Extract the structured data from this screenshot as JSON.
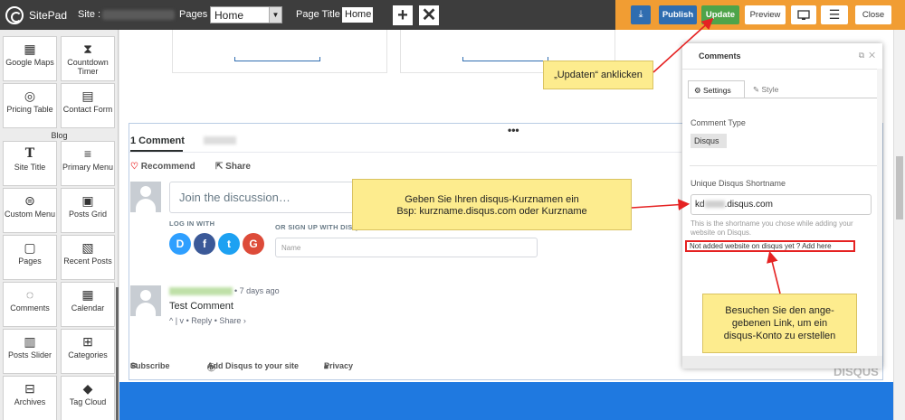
{
  "topbar": {
    "brand": "SitePad",
    "site_label": "Site :",
    "pages_label": "Pages :",
    "pages_value": "Home",
    "page_title_label": "Page Title :",
    "page_title_value": "Home",
    "buttons": {
      "publish": "Publish",
      "update": "Update",
      "preview": "Preview",
      "close": "Close"
    }
  },
  "sidebar": {
    "widgets_top": [
      {
        "label": "Google Maps",
        "icon": "grid-icon"
      },
      {
        "label": "Countdown Timer",
        "icon": "hourglass-icon"
      },
      {
        "label": "Pricing Table",
        "icon": "pricing-icon"
      },
      {
        "label": "Contact Form",
        "icon": "form-icon"
      }
    ],
    "section_blog": "Blog",
    "widgets_blog": [
      {
        "label": "Site Title",
        "icon": "text-icon"
      },
      {
        "label": "Primary Menu",
        "icon": "menu-icon"
      },
      {
        "label": "Custom Menu",
        "icon": "list-icon"
      },
      {
        "label": "Posts Grid",
        "icon": "posts-grid-icon"
      },
      {
        "label": "Pages",
        "icon": "pages-icon"
      },
      {
        "label": "Recent Posts",
        "icon": "recent-posts-icon"
      },
      {
        "label": "Comments",
        "icon": "comments-icon"
      },
      {
        "label": "Calendar",
        "icon": "calendar-icon"
      },
      {
        "label": "Posts Slider",
        "icon": "slider-icon"
      },
      {
        "label": "Categories",
        "icon": "categories-icon"
      },
      {
        "label": "Archives",
        "icon": "archives-icon"
      },
      {
        "label": "Tag Cloud",
        "icon": "tag-icon"
      }
    ]
  },
  "disqus": {
    "comment_count": "1 Comment",
    "recommend": "Recommend",
    "share": "Share",
    "join_placeholder": "Join the discussion…",
    "login_with": "LOG IN WITH",
    "signup_with": "OR SIGN UP WITH DISQUS",
    "name_placeholder": "Name",
    "comment_time": "• 7 days ago",
    "comment_text": "Test Comment",
    "comment_actions": "^ | v • Reply • Share ›",
    "footer": {
      "subscribe": "Subscribe",
      "add_disqus": "Add Disqus to your site",
      "privacy": "Privacy"
    },
    "logo": "DISQUS"
  },
  "panel": {
    "title": "Comments",
    "tab_settings": "Settings",
    "tab_style": "Style",
    "comment_type_label": "Comment Type",
    "comment_type_value": "Disqus",
    "shortname_label": "Unique Disqus Shortname",
    "shortname_prefix": "kd",
    "shortname_suffix": ".disqus.com",
    "help_text": "This is the shortname you chose while adding your website on Disqus.",
    "add_link": "Not added website on disqus yet ? Add here"
  },
  "annotations": {
    "update": "„Updaten“ anklicken",
    "shortname_line1": "Geben Sie Ihren disqus-Kurznamen ein",
    "shortname_line2": "Bsp: kurzname.disqus.com oder Kurzname",
    "visit_line1": "Besuchen Sie den ange-",
    "visit_line2": "gebenen Link, um ein",
    "visit_line3": "disqus-Konto zu erstellen"
  },
  "colors": {
    "topbar": "#3d3d3d",
    "accent_orange": "#f19d33",
    "update_green": "#4ea44a",
    "publish_blue": "#2f6db0",
    "annotation_yellow": "#fdec8e",
    "arrow_red": "#e52222"
  }
}
